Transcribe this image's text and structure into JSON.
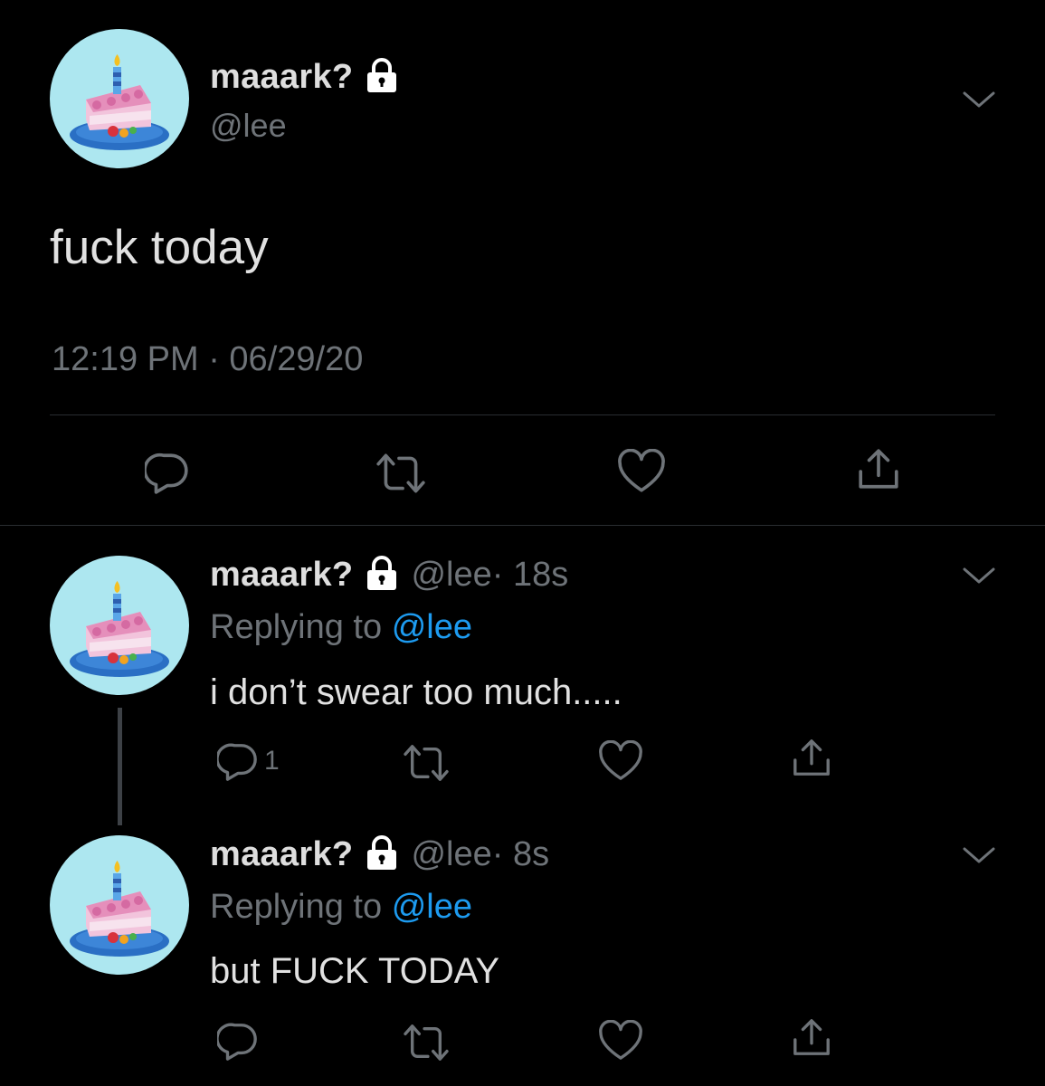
{
  "main_tweet": {
    "display_name": "maaark?",
    "handle": "@lee",
    "text": "fuck today",
    "timestamp": "12:19 PM · 06/29/20",
    "protected_icon": "lock-icon",
    "menu_icon": "chevron-down-icon",
    "actions": [
      {
        "name": "reply",
        "icon": "reply-icon"
      },
      {
        "name": "retweet",
        "icon": "retweet-icon"
      },
      {
        "name": "like",
        "icon": "heart-icon"
      },
      {
        "name": "share",
        "icon": "share-icon"
      }
    ]
  },
  "replies": [
    {
      "display_name": "maaark?",
      "handle": "@lee",
      "time": "· 18s",
      "replying_label": "Replying to",
      "replying_to": "@lee",
      "text": "i don’t swear too much.....",
      "reply_count": "1"
    },
    {
      "display_name": "maaark?",
      "handle": "@lee",
      "time": "· 8s",
      "replying_label": "Replying to",
      "replying_to": "@lee",
      "text": "but FUCK TODAY",
      "reply_count": ""
    }
  ],
  "colors": {
    "background": "#000000",
    "text_primary": "#e1e1e1",
    "text_secondary": "#6e7378",
    "link": "#1d9bf0",
    "avatar_bg": "#ade7f0"
  }
}
